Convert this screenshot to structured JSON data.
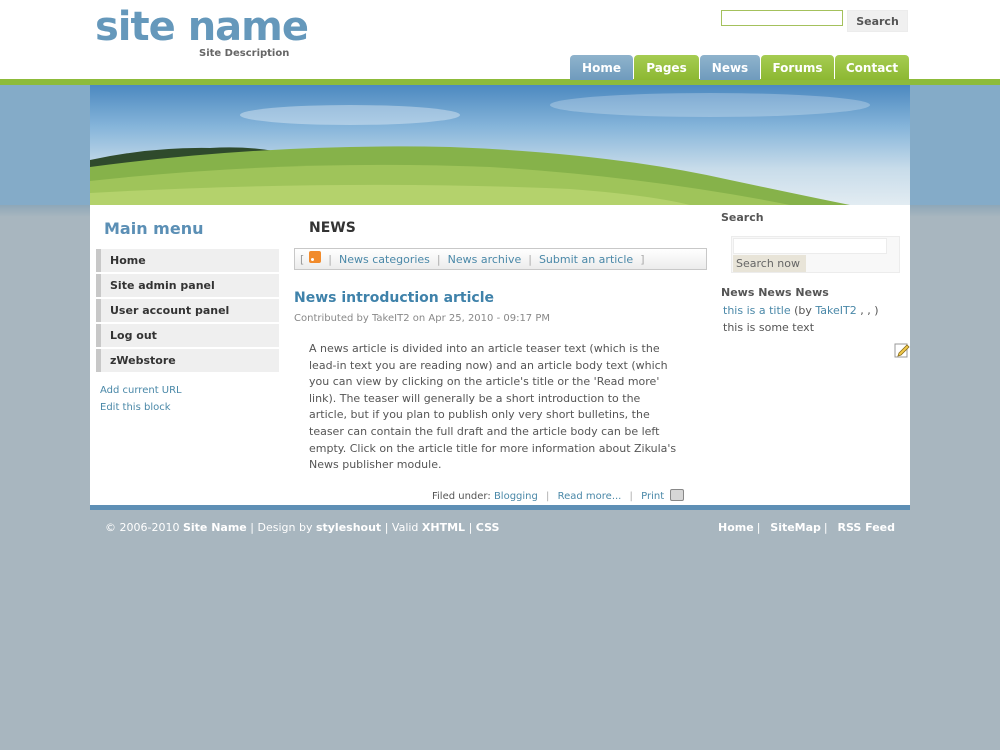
{
  "header": {
    "site_name": "site name",
    "site_description": "Site Description",
    "search_button": "Search",
    "search_value": "",
    "nav": [
      {
        "label": "Home",
        "color": "blue"
      },
      {
        "label": "Pages",
        "color": "green"
      },
      {
        "label": "News",
        "color": "blue"
      },
      {
        "label": "Forums",
        "color": "green"
      },
      {
        "label": "Contact",
        "color": "green"
      }
    ]
  },
  "sidebar": {
    "title": "Main menu",
    "items": [
      "Home",
      "Site admin panel",
      "User account panel",
      "Log out",
      "zWebstore"
    ],
    "links": [
      "Add current URL",
      "Edit this block"
    ]
  },
  "main": {
    "section_title": "NEWS",
    "bar": {
      "open_bracket": "[",
      "close_bracket": "]",
      "sep": "|",
      "links": [
        "News categories",
        "News archive",
        "Submit an article"
      ]
    },
    "article": {
      "title": "News introduction article",
      "meta": "Contributed by TakeIT2 on Apr 25, 2010 - 09:17 PM",
      "body": "A news article is divided into an article teaser text (which is the lead-in text you are reading now) and an article body text (which you can view by clicking on the article's title or the 'Read more' link). The teaser will generally be a short introduction to the article, but if you plan to publish only very short bulletins, the teaser can contain the full draft and the article body can be left empty. Click on the article title for more information about Zikula's News publisher module.",
      "filed_label": "Filed under:",
      "category": "Blogging",
      "read_more": "Read more...",
      "print": "Print"
    }
  },
  "right": {
    "search_title": "Search",
    "search_button": "Search now",
    "news_title": "News News News",
    "item_title": "this is a title",
    "item_by_prefix": "(by",
    "item_author": "TakeIT2",
    "item_by_suffix": ", , )",
    "item_text": "this is some text"
  },
  "footer": {
    "copyright": "© 2006-2010",
    "site_name": "Site Name",
    "design_by": "Design by",
    "designer": "styleshout",
    "valid": "Valid",
    "xhtml": "XHTML",
    "css": "CSS",
    "sep": "|",
    "links": [
      "Home",
      "SiteMap",
      "RSS Feed"
    ]
  },
  "colors": {
    "accent_blue": "#6598bb",
    "accent_green": "#8dbb3a",
    "link": "#4a88a8",
    "page_bg": "#a8b6bf"
  }
}
